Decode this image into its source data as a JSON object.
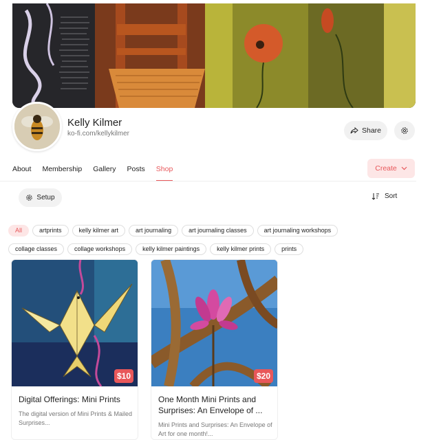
{
  "profile": {
    "name": "Kelly Kilmer",
    "url": "ko-fi.com/kellykilmer"
  },
  "actions": {
    "share_label": "Share",
    "create_label": "Create",
    "setup_label": "Setup",
    "sort_label": "Sort"
  },
  "tabs": [
    {
      "label": "About"
    },
    {
      "label": "Membership"
    },
    {
      "label": "Gallery"
    },
    {
      "label": "Posts"
    },
    {
      "label": "Shop"
    }
  ],
  "active_tab": "Shop",
  "filters_row1": [
    {
      "label": "All"
    },
    {
      "label": "artprints"
    },
    {
      "label": "kelly kilmer art"
    },
    {
      "label": "art journaling"
    },
    {
      "label": "art journaling classes"
    },
    {
      "label": "art journaling workshops"
    }
  ],
  "filters_row2": [
    {
      "label": "collage classes"
    },
    {
      "label": "collage workshops"
    },
    {
      "label": "kelly kilmer paintings"
    },
    {
      "label": "kelly kilmer prints"
    },
    {
      "label": "prints"
    }
  ],
  "products": [
    {
      "title": "Digital Offerings: Mini Prints",
      "price": "$10",
      "description": "The digital version of Mini Prints & Mailed Surprises..."
    },
    {
      "title": "One Month Mini Prints and Surprises: An Envelope of ...",
      "price": "$20",
      "description": "Mini Prints and Surprises: An Envelope of Art for one month!..."
    }
  ],
  "colors": {
    "accent": "#e8575a",
    "accent_light": "#fde6e6"
  },
  "icons": {
    "share": "share-icon",
    "settings": "gear-icon",
    "create_dropdown": "chevron-down-icon",
    "setup": "gear-icon",
    "sort": "sort-icon"
  }
}
